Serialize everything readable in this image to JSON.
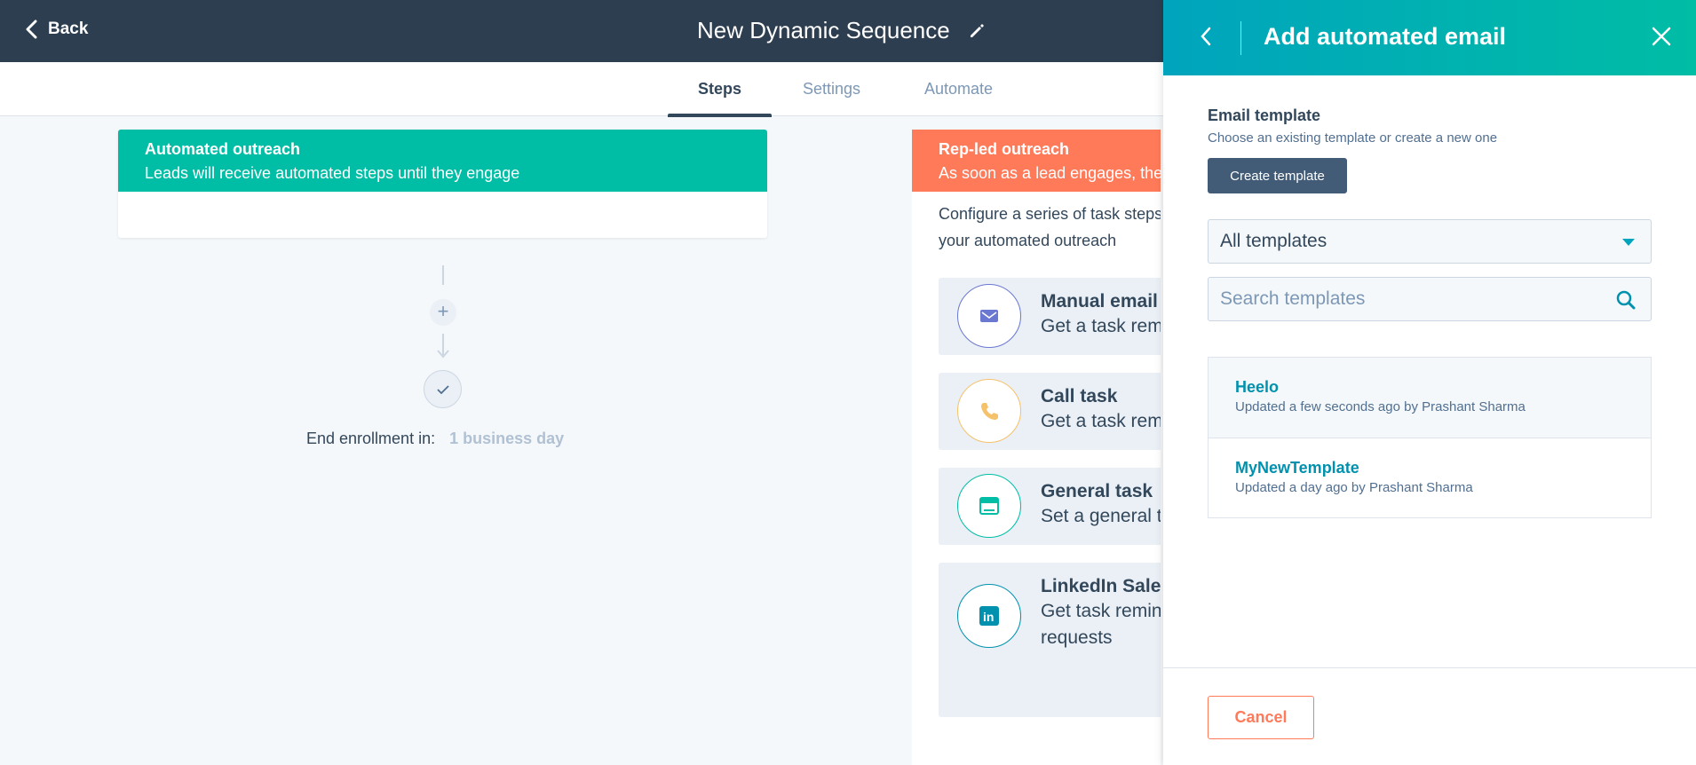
{
  "header": {
    "back_label": "Back",
    "title": "New Dynamic Sequence"
  },
  "tabs": [
    {
      "label": "Steps",
      "active": true
    },
    {
      "label": "Settings",
      "active": false
    },
    {
      "label": "Automate",
      "active": false
    }
  ],
  "automated": {
    "title": "Automated outreach",
    "subtitle": "Leads will receive automated steps until they engage"
  },
  "end_enrollment": {
    "label": "End enrollment in:",
    "value": "1 business day"
  },
  "rep_led": {
    "title": "Rep-led outreach",
    "subtitle": "As soon as a lead engages, the",
    "description_line1": "Configure a series of task steps",
    "description_line2": "your automated outreach",
    "tasks": [
      {
        "title": "Manual email",
        "sub1": "Get a task rem",
        "sub2": "",
        "icon": "envelope-icon"
      },
      {
        "title": "Call task",
        "sub1": "Get a task rem",
        "sub2": "",
        "icon": "phone-icon"
      },
      {
        "title": "General task",
        "sub1": "Set a general t",
        "sub2": "",
        "icon": "browser-icon"
      },
      {
        "title": "LinkedIn Sale",
        "sub1": "Get task remin",
        "sub2": "requests",
        "icon": "linkedin-icon"
      }
    ]
  },
  "panel": {
    "title": "Add automated email",
    "section_label": "Email template",
    "section_help": "Choose an existing template or create a new one",
    "create_button": "Create template",
    "filter_value": "All templates",
    "search_placeholder": "Search templates",
    "templates": [
      {
        "name": "Heelo",
        "meta": "Updated a few seconds ago by Prashant Sharma"
      },
      {
        "name": "MyNewTemplate",
        "meta": "Updated a day ago by Prashant Sharma"
      }
    ],
    "cancel_button": "Cancel"
  },
  "colors": {
    "topbar": "#2d3e50",
    "automated": "#00bda5",
    "rep_led": "#ff7a59",
    "panel_header": "#00a4bd",
    "link": "#0091ae"
  }
}
